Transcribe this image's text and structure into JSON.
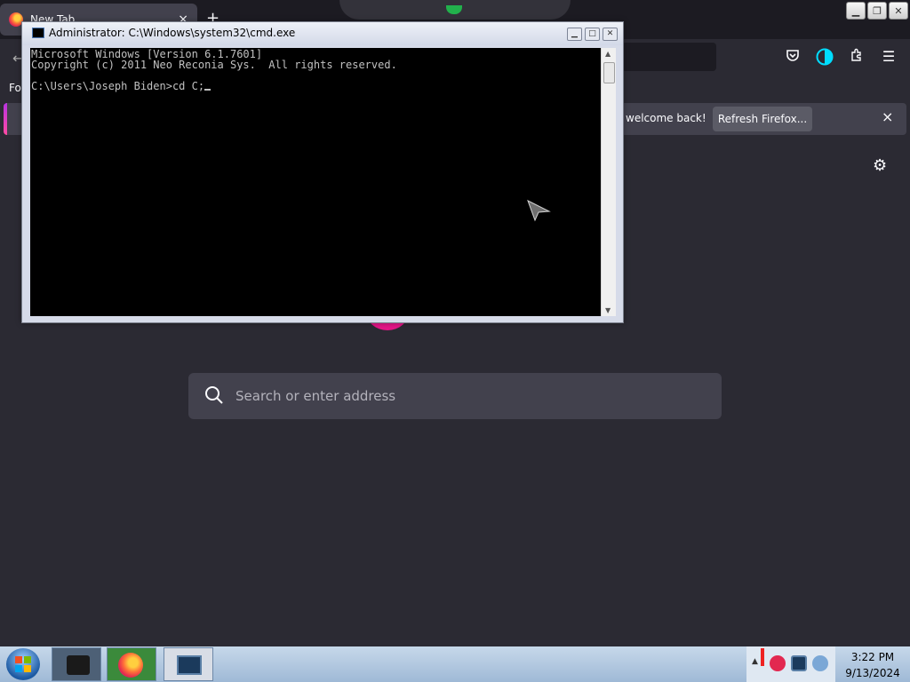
{
  "firefox": {
    "tab_title": "New Tab",
    "tab_close": "×",
    "new_tab_plus": "+",
    "bookmarks_label_cut": "Fo",
    "notification": {
      "message": "welcome back!",
      "button": "Refresh Firefox...",
      "close": "×"
    },
    "search_placeholder": "Search or enter address"
  },
  "cmd": {
    "title": "Administrator: C:\\Windows\\system32\\cmd.exe",
    "lines": [
      "Microsoft Windows [Version 6.1.7601]",
      "Copyright (c) 2011 Neo Reconia Sys.  All rights reserved.",
      "",
      "C:\\Users\\Joseph Biden>cd C;"
    ]
  },
  "taskbar": {
    "time": "3:22 PM",
    "date": "9/13/2024"
  },
  "icons": {
    "firefox": "firefox-icon",
    "cmd": "cmd-icon",
    "search": "search-icon",
    "settings": "gear-icon",
    "start": "windows-start-icon"
  },
  "colors": {
    "firefox_bg": "#2b2a33",
    "console_bg": "#000000",
    "console_text": "#c0c0c0",
    "accent_pink": "#e31587"
  }
}
